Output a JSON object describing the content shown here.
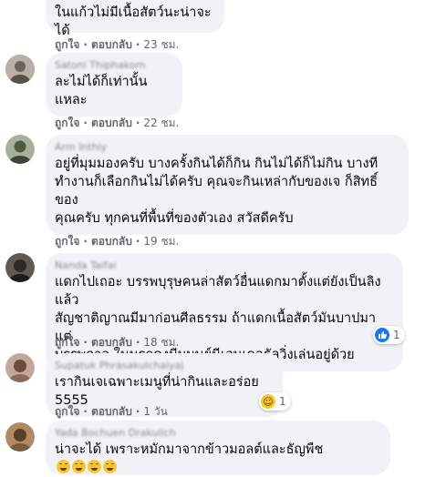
{
  "actions": {
    "like": "ถูกใจ",
    "reply": "ตอบกลับ",
    "separator": "·"
  },
  "comments": [
    {
      "author": "",
      "text": "ในแก้วไม่มีเนื้อสัตว์นะน่าจะได้",
      "time": "23 ชม.",
      "avatar_color": "#c9c3bd"
    },
    {
      "author": "Satoni Thiphakorn",
      "text": "ละไม่ได้ก็เท่านั้นแหละ",
      "time": "22 ชม.",
      "avatar_color": "#9a8f86"
    },
    {
      "author": "Arm Inthiy",
      "text": "อยู่ที่มุมมองครับ บางครั้งกินได้ก็กิน กินไม่ได้ก็ไม่กิน บางที\nทำงานก็เลือกกินไม่ได้ครับ คุณจะกินเหล่ากับของเจ ก็สิทธิ์ของ\nคุณครับ ทุกคนที่พื้นที่ของตัวเอง สวัสดีครับ",
      "time": "19 ชม.",
      "avatar_color": "#7d8a6e"
    },
    {
      "author": "Nanda Taifai",
      "text": "แดกไปเถอะ บรรพบุรุษคนล่าสัตว์อื่นแดกมาตั้งแต่ยังเป็นลิงแล้ว\nสัญชาติญาณมีมาก่อนศีลธรรม ถ้าแดกเนื้อสัตว์มันบาปมาแต่\nบรรพกาล ในนรกคงมีมนุษย์นีเอนเดอธัลวิ่งเล่นอยู่ด้วย",
      "time": "18 ชม.",
      "avatar_color": "#3d3a36",
      "reaction": {
        "icon": "like-icon",
        "count": "1",
        "color": "#1877f2"
      }
    },
    {
      "author": "Supatuk Phrasakulchaiyaj",
      "text": "เรากินเจเฉพาะเมนูที่น่ากินและอร่อย 5555",
      "time": "1 วัน",
      "avatar_color": "#8a6a5e",
      "reaction": {
        "icon": "haha-icon",
        "count": "1",
        "color": "#f7c532"
      }
    },
    {
      "author": "Yada Bochuen Drakulich",
      "text": "น่าจะได้ เพราะหมักมาจากข้าวมอลต์และธัญพืช",
      "time": "",
      "avatar_color": "#7a5a3c",
      "trailing_emojis": "grinning-face-icon x4"
    }
  ]
}
